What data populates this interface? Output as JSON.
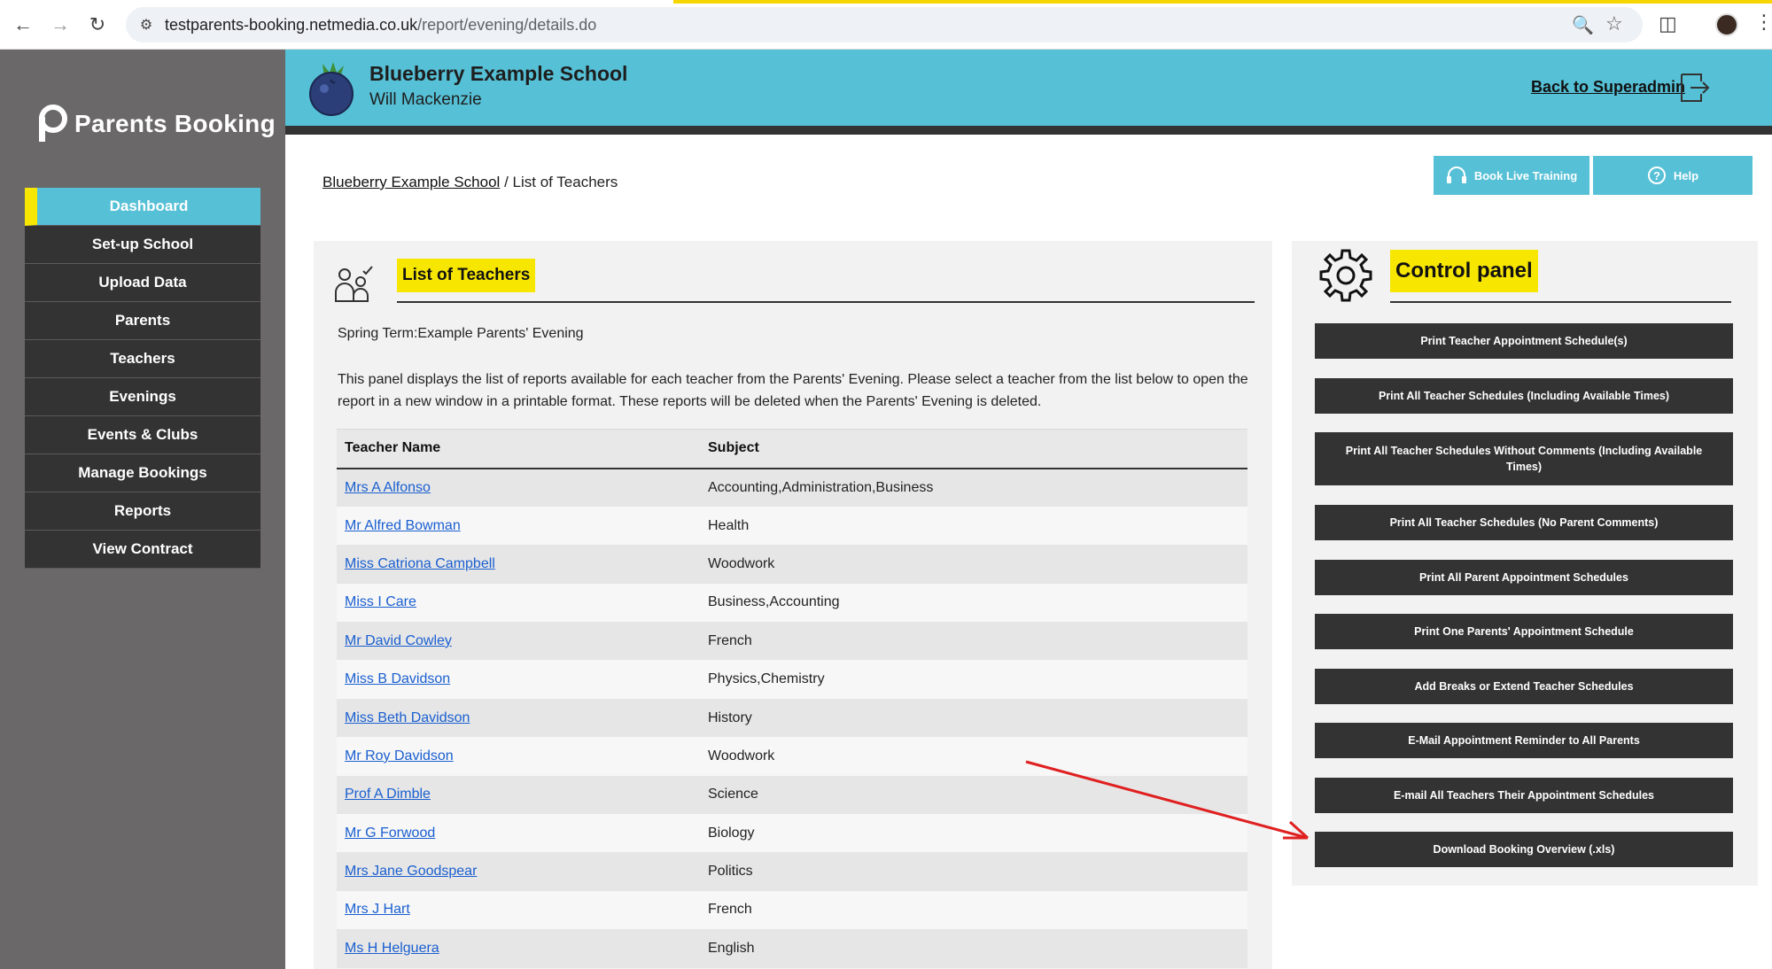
{
  "browser": {
    "url_host": "testparents-booking.netmedia.co.uk",
    "url_path": "/report/evening/details.do"
  },
  "sidebar": {
    "brand": "Parents Booking",
    "items": [
      {
        "label": "Dashboard"
      },
      {
        "label": "Set-up School"
      },
      {
        "label": "Upload Data"
      },
      {
        "label": "Parents"
      },
      {
        "label": "Teachers"
      },
      {
        "label": "Evenings"
      },
      {
        "label": "Events & Clubs"
      },
      {
        "label": "Manage Bookings"
      },
      {
        "label": "Reports"
      },
      {
        "label": "View Contract"
      }
    ]
  },
  "header": {
    "school_name": "Blueberry Example School",
    "user_name": "Will Mackenzie",
    "back_link": "Back to Superadmin"
  },
  "breadcrumb": {
    "school_link": "Blueberry Example School",
    "separator": "/",
    "current": "List of Teachers"
  },
  "top_buttons": {
    "training": "Book Live Training",
    "help": "Help"
  },
  "main_panel": {
    "title": "List of Teachers",
    "evening_name": "Spring Term:Example Parents' Evening",
    "description": "This panel displays the list of reports available for each teacher from the Parents' Evening. Please select a teacher from the list below to open the report in a new window in a printable format. These reports will be deleted when the Parents' Evening is deleted.",
    "columns": [
      "Teacher Name",
      "Subject"
    ],
    "rows": [
      {
        "name": "Mrs A Alfonso",
        "subject": "Accounting,Administration,Business"
      },
      {
        "name": "Mr Alfred Bowman",
        "subject": "Health"
      },
      {
        "name": "Miss Catriona Campbell",
        "subject": "Woodwork"
      },
      {
        "name": "Miss I Care",
        "subject": "Business,Accounting"
      },
      {
        "name": "Mr David Cowley",
        "subject": "French"
      },
      {
        "name": "Miss B Davidson",
        "subject": "Physics,Chemistry"
      },
      {
        "name": "Miss Beth Davidson",
        "subject": "History"
      },
      {
        "name": "Mr Roy Davidson",
        "subject": "Woodwork"
      },
      {
        "name": "Prof A Dimble",
        "subject": "Science"
      },
      {
        "name": "Mr G Forwood",
        "subject": "Biology"
      },
      {
        "name": "Mrs Jane Goodspear",
        "subject": "Politics"
      },
      {
        "name": "Mrs J Hart",
        "subject": "French"
      },
      {
        "name": "Ms H Helguera",
        "subject": "English"
      }
    ]
  },
  "control_panel": {
    "title": "Control panel",
    "buttons": [
      {
        "label": "Print Teacher Appointment Schedule(s)"
      },
      {
        "label": "Print All Teacher Schedules (Including Available Times)"
      },
      {
        "label": "Print All Teacher Schedules Without Comments (Including Available Times)"
      },
      {
        "label": "Print All Teacher Schedules (No Parent Comments)"
      },
      {
        "label": "Print All Parent Appointment Schedules"
      },
      {
        "label": "Print One Parents' Appointment Schedule"
      },
      {
        "label": "Add Breaks or Extend Teacher Schedules"
      },
      {
        "label": "E-Mail Appointment Reminder to All Parents"
      },
      {
        "label": "E-mail All Teachers Their Appointment Schedules"
      },
      {
        "label": "Download Booking Overview (.xls)"
      }
    ]
  },
  "colors": {
    "accent": "#56c0d6",
    "highlight": "#f7e600",
    "dark": "#343334",
    "sidebar_bg": "#6a6869",
    "link": "#1a5fd0",
    "annotation_arrow": "#e02020"
  }
}
